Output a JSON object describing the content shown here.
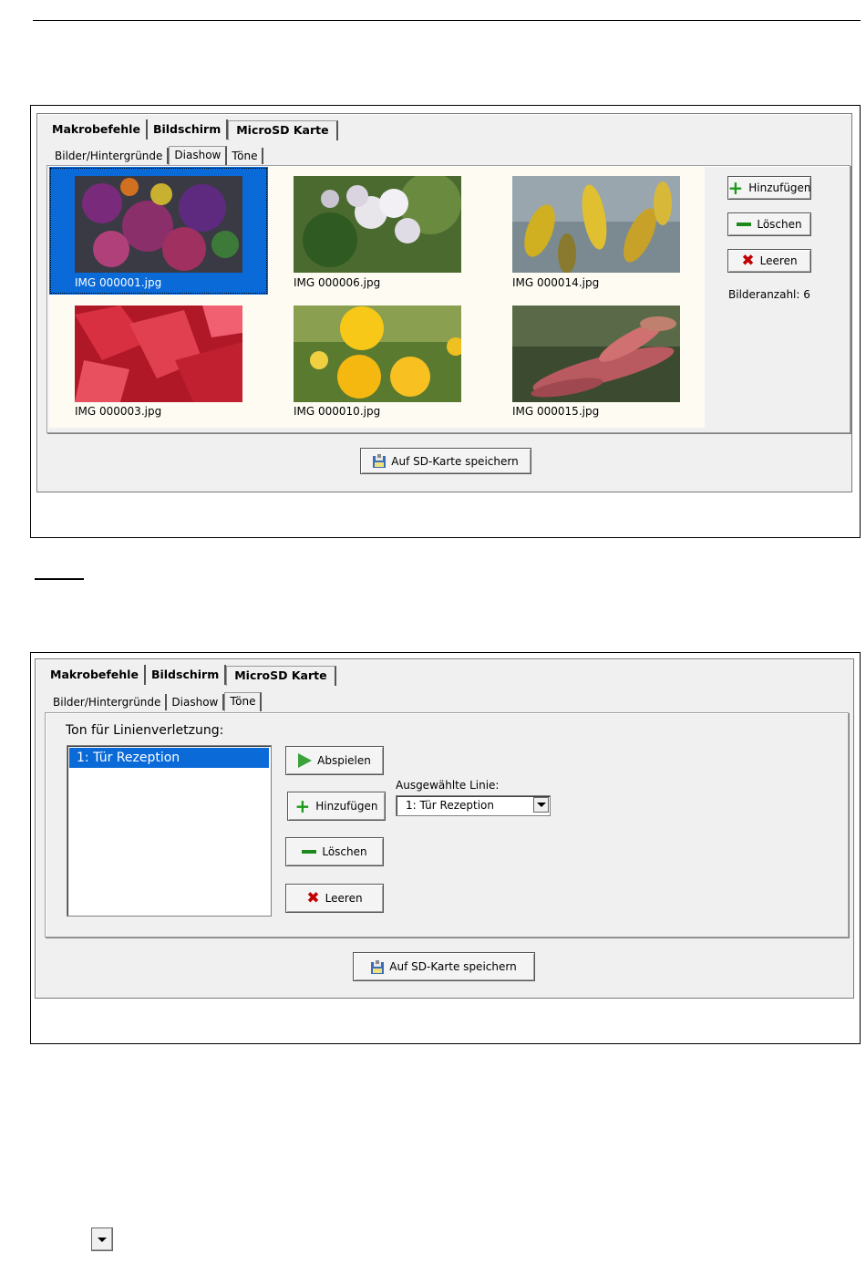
{
  "screen1": {
    "tabs": [
      "Makrobefehle",
      "Bildschirm",
      "MicroSD Karte"
    ],
    "subtabs": [
      "Bilder/Hintergründe",
      "Diashow",
      "Töne"
    ],
    "images": [
      {
        "caption": "IMG 000001.jpg",
        "selected": true
      },
      {
        "caption": "IMG 000006.jpg",
        "selected": false
      },
      {
        "caption": "IMG 000014.jpg",
        "selected": false
      },
      {
        "caption": "IMG 000003.jpg",
        "selected": false
      },
      {
        "caption": "IMG 000010.jpg",
        "selected": false
      },
      {
        "caption": "IMG 000015.jpg",
        "selected": false
      }
    ],
    "buttons": {
      "add": "Hinzufügen",
      "delete": "Löschen",
      "clear": "Leeren",
      "save": "Auf SD-Karte speichern"
    },
    "image_count": "Bilderanzahl: 6"
  },
  "screen2": {
    "tabs": [
      "Makrobefehle",
      "Bildschirm",
      "MicroSD Karte"
    ],
    "subtabs": [
      "Bilder/Hintergründe",
      "Diashow",
      "Töne"
    ],
    "tone_label": "Ton für Linienverletzung:",
    "list_items": [
      "1: Tür Rezeption"
    ],
    "buttons": {
      "play": "Abspielen",
      "add": "Hinzufügen",
      "delete": "Löschen",
      "clear": "Leeren",
      "save": "Auf SD-Karte speichern"
    },
    "line_label": "Ausgewählte Linie:",
    "line_value": "1: Tür Rezeption"
  },
  "colors": {
    "selection": "#0a6ad8",
    "thumb_bg": "#fdfbf2",
    "plus": "#1b9a1b",
    "x": "#c00000"
  }
}
